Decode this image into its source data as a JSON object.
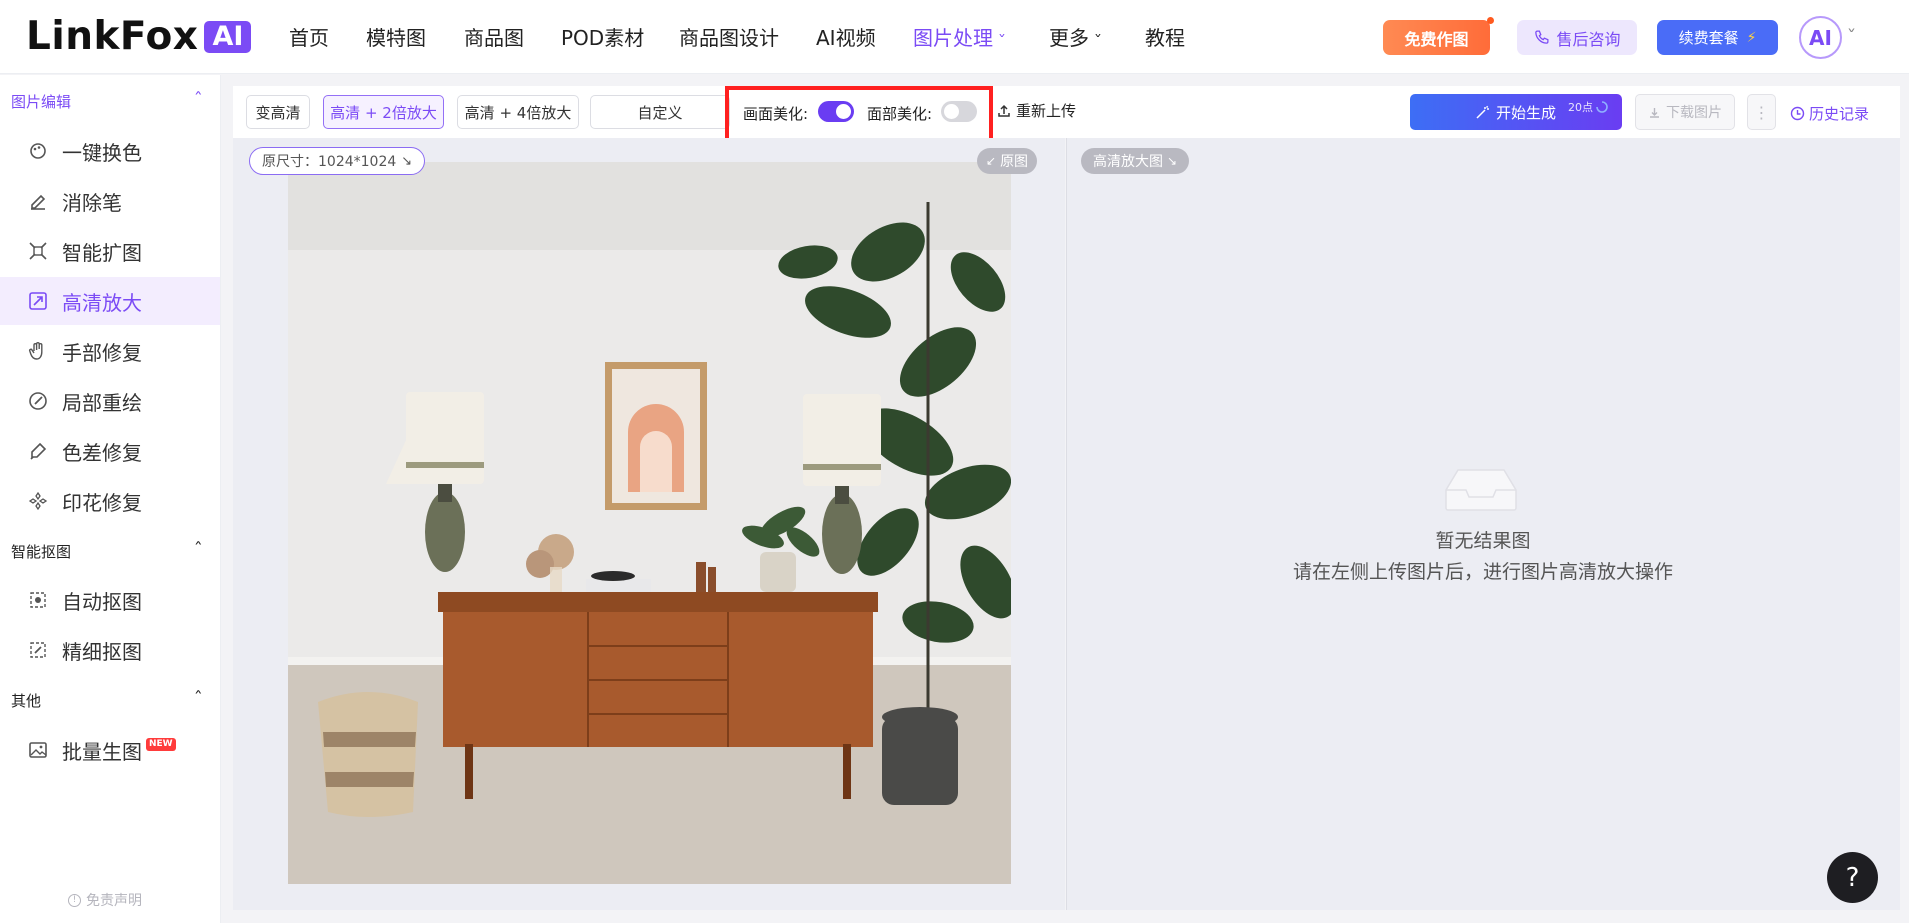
{
  "header": {
    "logo_text": "LinkFox",
    "logo_ai": "AI",
    "nav": [
      {
        "label": "首页"
      },
      {
        "label": "模特图"
      },
      {
        "label": "商品图"
      },
      {
        "label": "POD素材"
      },
      {
        "label": "商品图设计"
      },
      {
        "label": "AI视频"
      },
      {
        "label": "图片处理"
      },
      {
        "label": "更多"
      },
      {
        "label": "教程"
      }
    ],
    "free_button": "免费作图",
    "support_button": "售后咨询",
    "renew_button": "续费套餐",
    "avatar_text": "AI"
  },
  "sidebar": {
    "sections": [
      {
        "title": "图片编辑",
        "items": [
          {
            "label": "一键换色"
          },
          {
            "label": "消除笔"
          },
          {
            "label": "智能扩图"
          },
          {
            "label": "高清放大"
          },
          {
            "label": "手部修复"
          },
          {
            "label": "局部重绘"
          },
          {
            "label": "色差修复"
          },
          {
            "label": "印花修复"
          }
        ]
      },
      {
        "title": "智能抠图",
        "items": [
          {
            "label": "自动抠图"
          },
          {
            "label": "精细抠图"
          }
        ]
      },
      {
        "title": "其他",
        "items": [
          {
            "label": "批量生图",
            "badge": "NEW"
          }
        ]
      }
    ],
    "active_item": "高清放大",
    "disclaimer": "免责声明"
  },
  "toolbar": {
    "modes": [
      {
        "label": "变高清"
      },
      {
        "label": "高清 + 2倍放大"
      },
      {
        "label": "高清 + 4倍放大"
      },
      {
        "label": "自定义"
      }
    ],
    "selected_mode": "高清 + 2倍放大",
    "scene_beautify_label": "画面美化:",
    "scene_beautify_on": true,
    "face_beautify_label": "面部美化:",
    "face_beautify_on": false,
    "reupload_label": "重新上传",
    "generate_label": "开始生成",
    "generate_cost": "20点",
    "download_label": "下载图片",
    "history_label": "历史记录"
  },
  "left_panel": {
    "size_badge": "原尺寸：1024*1024",
    "original_tag": "原图"
  },
  "right_panel": {
    "tag": "高清放大图",
    "empty_title": "暂无结果图",
    "empty_desc": "请在左侧上传图片后，进行图片高清放大操作"
  },
  "colors": {
    "accent": "#7b4bf5",
    "highlight_box": "#ff2020",
    "free_button": "#ff7540",
    "renew_button": "#4a6cf7"
  }
}
